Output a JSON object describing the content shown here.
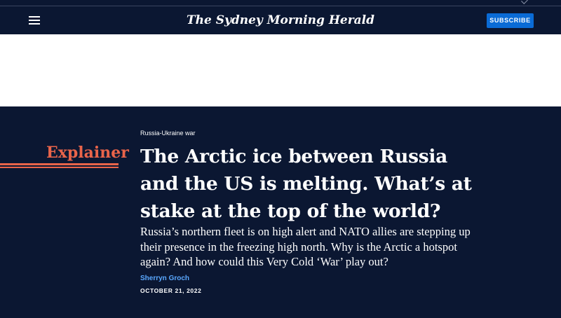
{
  "header": {
    "menu_icon": "hamburger-menu-icon",
    "logo_text": "The Sydney Morning Herald",
    "subscribe_label": "SUBSCRIBE"
  },
  "article": {
    "section": "Russia-Ukraine war",
    "label": "Explainer",
    "headline": "The Arctic ice between Russia and the US is melting. What’s at stake at the top of the world?",
    "standfirst": "Russia’s northern fleet is on high alert and NATO allies are stepping up their presence in the freezing high north. Why is the Arctic a hotspot again? And how could this Very Cold ‘War’ play out?",
    "author": "Sherryn Groch",
    "date": "OCTOBER 21, 2022"
  },
  "colors": {
    "navy": "#0b1732",
    "accent": "#e9644a",
    "subscribe": "#0a6bd6",
    "byline": "#5aa8ff"
  }
}
